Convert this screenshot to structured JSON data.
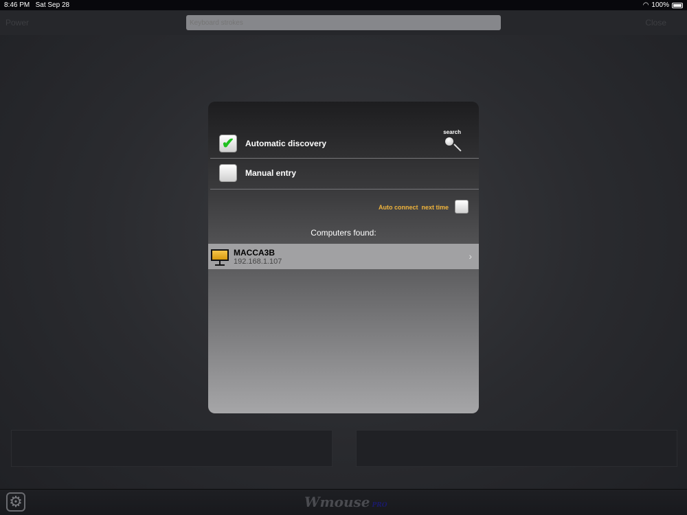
{
  "status": {
    "time": "8:46 PM",
    "date": "Sat Sep 28",
    "battery": "100%"
  },
  "toolbar": {
    "power": "Power",
    "keyboard_placeholder": "Keyboard strokes",
    "close": "Close"
  },
  "dialog": {
    "automatic_discovery": {
      "label": "Automatic discovery",
      "checked": true
    },
    "manual_entry": {
      "label": "Manual entry",
      "checked": false
    },
    "search_label": "search",
    "auto_connect_label": "Auto connect  next time",
    "auto_connect_checked": false,
    "computers_found_label": "Computers found:",
    "computers": [
      {
        "name": "MACCA3B",
        "ip": "192.168.1.107"
      }
    ]
  },
  "footer": {
    "logo": "Wmouse",
    "logo_suffix": "PRO"
  }
}
